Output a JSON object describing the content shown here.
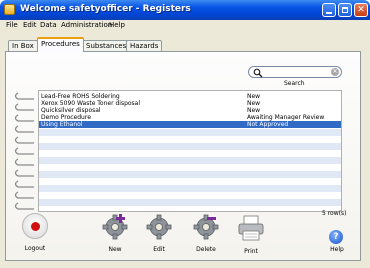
{
  "window": {
    "title": "Welcome safetyofficer - Registers"
  },
  "menu": [
    "File",
    "Edit",
    "Data",
    "Administration",
    "Help"
  ],
  "tabs": [
    {
      "label": "In Box",
      "active": false
    },
    {
      "label": "Procedures",
      "active": true
    },
    {
      "label": "Substances",
      "active": false
    },
    {
      "label": "Hazards",
      "active": false
    }
  ],
  "search": {
    "label": "Search",
    "value": ""
  },
  "table": {
    "rows": [
      {
        "name": "Lead-Free ROHS Soldering",
        "status": "New"
      },
      {
        "name": "Xerox 5090 Waste Toner disposal",
        "status": "New"
      },
      {
        "name": "Quicksilver disposal",
        "status": "New"
      },
      {
        "name": "Demo Procedure",
        "status": "Awaiting Manager Review"
      },
      {
        "name": "Using Ethanol",
        "status": "Not Approved",
        "selected": true
      }
    ],
    "row_count": "5 row(s)"
  },
  "toolbar": {
    "logout": "Logout",
    "new": "New",
    "edit": "Edit",
    "delete": "Delete",
    "print": "Print",
    "help": "Help"
  },
  "colors": {
    "selection": "#316ac5",
    "titlebar": "#0a55e6",
    "active_tab_accent": "#e8a010"
  }
}
